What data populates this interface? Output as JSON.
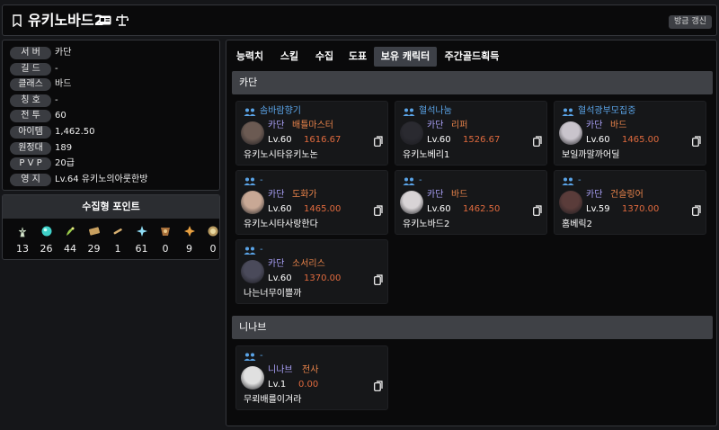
{
  "header": {
    "title": "유키노바드2",
    "refresh_label": "방금 갱신",
    "pin_icon": "bookmark-icon",
    "card_icon": "id-card-icon",
    "scale_icon": "scale-icon"
  },
  "info": [
    {
      "label": "서 버",
      "value": "카단"
    },
    {
      "label": "길 드",
      "value": "-"
    },
    {
      "label": "클래스",
      "value": "바드"
    },
    {
      "label": "칭 호",
      "value": "-"
    },
    {
      "label": "전 투",
      "value": "60"
    },
    {
      "label": "아이템",
      "value": "1,462.50"
    },
    {
      "label": "원정대",
      "value": "189"
    },
    {
      "label": "P V P",
      "value": "20급"
    },
    {
      "label": "영 지",
      "value": "Lv.64 유키노의아룻한방"
    }
  ],
  "collection": {
    "title": "수집형 포인트",
    "items": [
      {
        "icon": "mokoko-seed-icon",
        "value": "13"
      },
      {
        "icon": "island-heart-icon",
        "value": "26"
      },
      {
        "icon": "giants-heart-icon",
        "value": "44"
      },
      {
        "icon": "art-icon",
        "value": "29"
      },
      {
        "icon": "ignea-token-icon",
        "value": "1"
      },
      {
        "icon": "world-tree-leaf-icon",
        "value": "61"
      },
      {
        "icon": "sea-bounty-icon",
        "value": "0"
      },
      {
        "icon": "star-icon",
        "value": "9"
      },
      {
        "icon": "orpheus-star-icon",
        "value": "0"
      }
    ]
  },
  "tabs": [
    "능력치",
    "스킬",
    "수집",
    "도표",
    "보유 캐릭터",
    "주간골드획득"
  ],
  "active_tab": "보유 캐릭터",
  "groups": [
    {
      "server": "카단",
      "characters": [
        {
          "guild": "솜바람향기",
          "server": "카단",
          "class": "배틀마스터",
          "level": "Lv.60",
          "item_level": "1616.67",
          "name": "유키노시타유키노논",
          "avatar_color": "#6b5a52"
        },
        {
          "guild": "혈석나눔",
          "server": "카단",
          "class": "리퍼",
          "level": "Lv.60",
          "item_level": "1526.67",
          "name": "유키노베리1",
          "avatar_color": "#2a2a30"
        },
        {
          "guild": "혈석광부모집중",
          "server": "카단",
          "class": "바드",
          "level": "Lv.60",
          "item_level": "1465.00",
          "name": "보일까말까어딜",
          "avatar_color": "#c9c4cc"
        },
        {
          "guild": "-",
          "server": "카단",
          "class": "도화가",
          "level": "Lv.60",
          "item_level": "1465.00",
          "name": "유키노시타사랑한다",
          "avatar_color": "#c8a895"
        },
        {
          "guild": "-",
          "server": "카단",
          "class": "바드",
          "level": "Lv.60",
          "item_level": "1462.50",
          "name": "유키노바드2",
          "avatar_color": "#d8d4d6"
        },
        {
          "guild": "-",
          "server": "카단",
          "class": "건슬링어",
          "level": "Lv.59",
          "item_level": "1370.00",
          "name": "홈베릭2",
          "avatar_color": "#5a3c3a"
        },
        {
          "guild": "-",
          "server": "카단",
          "class": "소서리스",
          "level": "Lv.60",
          "item_level": "1370.00",
          "name": "나는너무이쁠까",
          "avatar_color": "#4a4a5a"
        }
      ]
    },
    {
      "server": "니나브",
      "characters": [
        {
          "guild": "-",
          "server": "니나브",
          "class": "전사",
          "level": "Lv.1",
          "item_level": "0.00",
          "name": "무뢰배를이겨라",
          "avatar_color": "#e0e0e0"
        }
      ]
    }
  ],
  "colors": {
    "server": "#a89ff5",
    "class": "#e8834a",
    "item_level": "#e06a3e",
    "guild": "#5aa4e8"
  }
}
